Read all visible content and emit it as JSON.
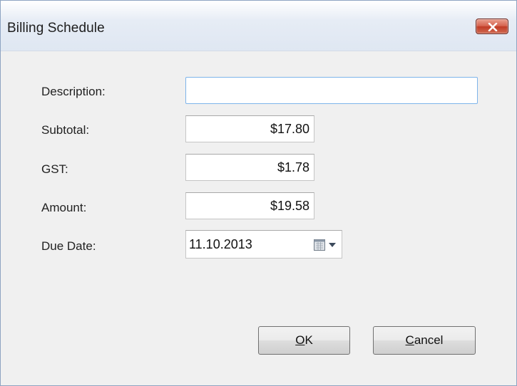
{
  "window": {
    "title": "Billing Schedule"
  },
  "form": {
    "description": {
      "label": "Description:",
      "value": ""
    },
    "subtotal": {
      "label": "Subtotal:",
      "value": "$17.80"
    },
    "gst": {
      "label": "GST:",
      "value": "$1.78"
    },
    "amount": {
      "label": "Amount:",
      "value": "$19.58"
    },
    "due_date": {
      "label": "Due Date:",
      "value": "11.10.2013"
    }
  },
  "buttons": {
    "ok": {
      "mnemonic": "O",
      "rest": "K"
    },
    "cancel": {
      "mnemonic": "C",
      "rest": "ancel"
    }
  },
  "colors": {
    "close_button": "#c9452d",
    "focus_border": "#7eb4ea"
  },
  "icons": {
    "close": "close-icon",
    "calendar": "calendar-icon",
    "dropdown": "chevron-down-icon"
  }
}
